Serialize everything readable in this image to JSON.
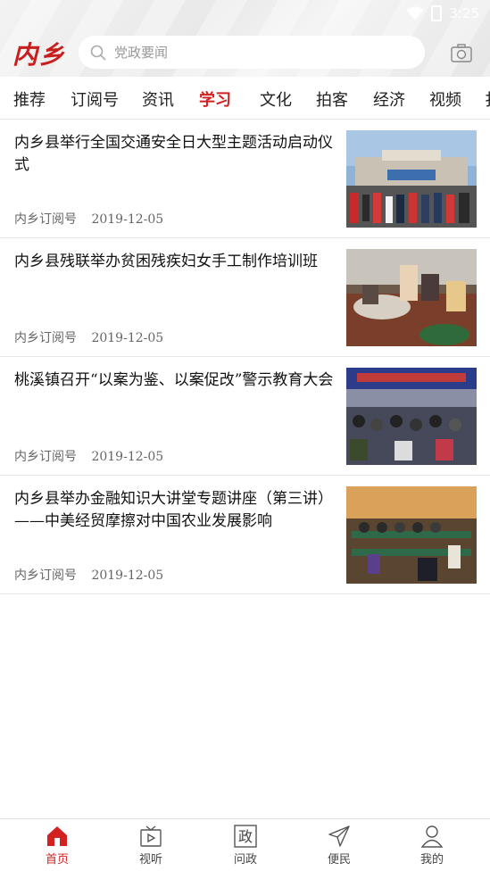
{
  "status": {
    "time": "3:25"
  },
  "header": {
    "logo": "内乡",
    "search_placeholder": "党政要闻"
  },
  "tabs": [
    {
      "label": "推荐"
    },
    {
      "label": "订阅号"
    },
    {
      "label": "资讯"
    },
    {
      "label": "学习"
    },
    {
      "label": "文化"
    },
    {
      "label": "拍客"
    },
    {
      "label": "经济"
    },
    {
      "label": "视频"
    },
    {
      "label": "扌"
    }
  ],
  "active_tab": "学习",
  "articles": [
    {
      "title": "内乡县举行全国交通安全日大型主题活动启动仪式",
      "source": "内乡订阅号",
      "date": "2019-12-05"
    },
    {
      "title": "内乡县残联举办贫困残疾妇女手工制作培训班",
      "source": "内乡订阅号",
      "date": "2019-12-05"
    },
    {
      "title": "桃溪镇召开“以案为鉴、以案促改”警示教育大会",
      "source": "内乡订阅号",
      "date": "2019-12-05"
    },
    {
      "title": "内乡县举办金融知识大讲堂专题讲座（第三讲）——中美经贸摩擦对中国农业发展影响",
      "source": "内乡订阅号",
      "date": "2019-12-05"
    }
  ],
  "bottom_nav": [
    {
      "label": "首页"
    },
    {
      "label": "视听"
    },
    {
      "label": "问政"
    },
    {
      "label": "便民"
    },
    {
      "label": "我的"
    }
  ],
  "colors": {
    "accent": "#d22121"
  }
}
